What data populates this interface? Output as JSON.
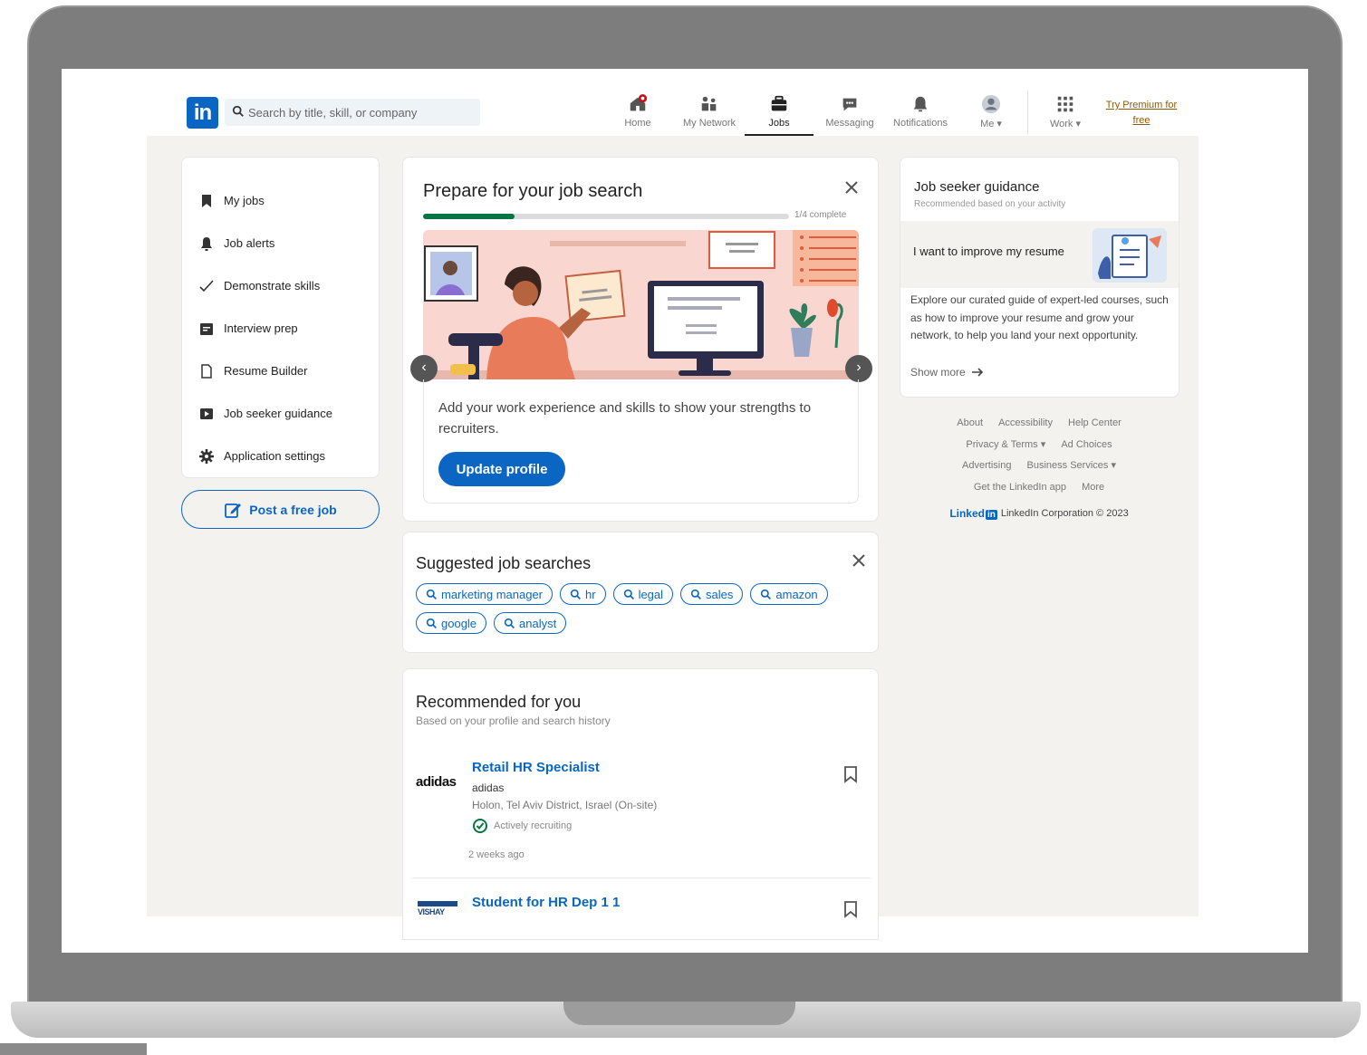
{
  "nav": {
    "search_placeholder": "Search by title, skill, or company",
    "items": [
      {
        "label": "Home",
        "icon": "home-icon"
      },
      {
        "label": "My Network",
        "icon": "network-icon"
      },
      {
        "label": "Jobs",
        "icon": "briefcase-icon"
      },
      {
        "label": "Messaging",
        "icon": "messaging-icon"
      },
      {
        "label": "Notifications",
        "icon": "bell-icon"
      },
      {
        "label": "Me ▾",
        "icon": "avatar"
      },
      {
        "label": "Work ▾",
        "icon": "grid-icon"
      }
    ],
    "premium_line1": "Try Premium for",
    "premium_line2": "free",
    "active_item": "Jobs"
  },
  "sidebar": {
    "items": [
      {
        "label": "My jobs",
        "icon": "bookmark-icon"
      },
      {
        "label": "Job alerts",
        "icon": "bell-icon"
      },
      {
        "label": "Demonstrate skills",
        "icon": "checkmark-icon"
      },
      {
        "label": "Interview prep",
        "icon": "clipboard-icon"
      },
      {
        "label": "Resume Builder",
        "icon": "document-icon"
      },
      {
        "label": "Job seeker guidance",
        "icon": "video-icon"
      },
      {
        "label": "Application settings",
        "icon": "gear-icon"
      }
    ],
    "post_job_label": "Post a free job"
  },
  "prepare": {
    "title": "Prepare for your job search",
    "progress_label": "1/4 complete",
    "progress_fraction": 0.25,
    "body": "Add your work experience and skills to show your strengths to recruiters.",
    "button": "Update profile"
  },
  "suggested": {
    "title": "Suggested job searches",
    "chips": [
      "marketing manager",
      "hr",
      "legal",
      "sales",
      "amazon",
      "google",
      "analyst"
    ]
  },
  "recommended": {
    "title": "Recommended for you",
    "subtitle": "Based on your profile and search history",
    "jobs": [
      {
        "logo": "adidas",
        "title": "Retail HR Specialist",
        "company": "adidas",
        "location": "Holon, Tel Aviv District, Israel (On-site)",
        "status": "Actively recruiting",
        "age": "2 weeks ago"
      },
      {
        "logo": "VISHAY",
        "title": "Student for HR Dep 1 1"
      }
    ]
  },
  "guidance": {
    "title": "Job seeker guidance",
    "subtitle": "Recommended based on your activity",
    "banner": "I want to improve my resume",
    "body": "Explore our curated guide of expert-led courses, such as how to improve your resume and grow your network, to help you land your next opportunity.",
    "more": "Show more"
  },
  "footer": {
    "rows": [
      [
        "About",
        "Accessibility",
        "Help Center"
      ],
      [
        "Privacy & Terms ▾",
        "Ad Choices"
      ],
      [
        "Advertising",
        "Business Services ▾"
      ],
      [
        "Get the LinkedIn app",
        "More"
      ]
    ],
    "brand_word": "Linked",
    "brand_in": "in",
    "copyright": "LinkedIn Corporation © 2023"
  },
  "colors": {
    "accent": "#0a66c2",
    "progress": "#057642",
    "premium": "#915907",
    "background": "#f3f2ef"
  }
}
